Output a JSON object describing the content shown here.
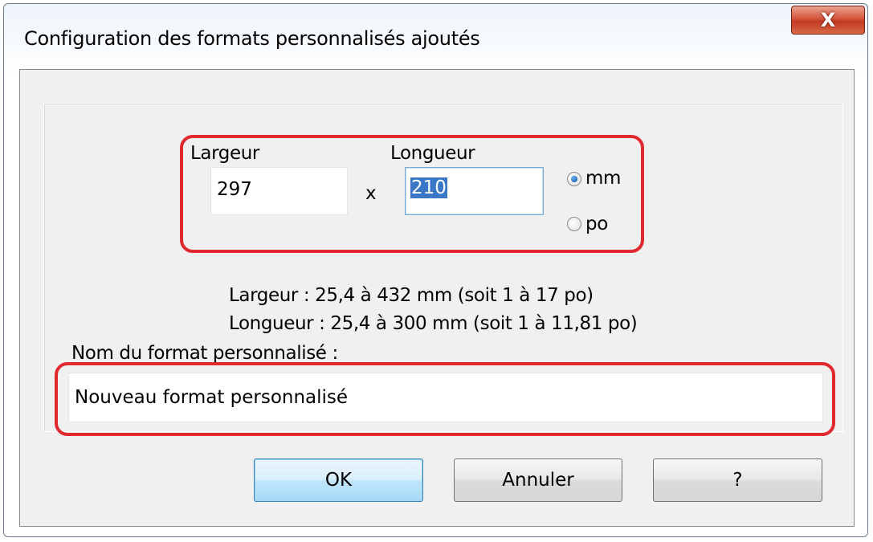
{
  "window": {
    "title": "Configuration des formats personnalisés ajoutés",
    "close_label": "X"
  },
  "size": {
    "width_label": "Largeur",
    "width_value": "297",
    "separator": "x",
    "length_label": "Longueur",
    "length_value": "210",
    "units": [
      {
        "label": "mm",
        "checked": true
      },
      {
        "label": "po",
        "checked": false
      }
    ]
  },
  "ranges": {
    "width_range": "Largeur : 25,4 à 432 mm (soit 1 à 17 po)",
    "length_range": "Longueur : 25,4 à 300 mm (soit 1 à 11,81 po)"
  },
  "name": {
    "label": "Nom du format personnalisé :",
    "value": "Nouveau format personnalisé"
  },
  "buttons": {
    "ok": "OK",
    "cancel": "Annuler",
    "help": "?"
  },
  "colors": {
    "highlight": "#e0282f",
    "selection": "#3a77c7",
    "close_button": "#c23a22"
  }
}
